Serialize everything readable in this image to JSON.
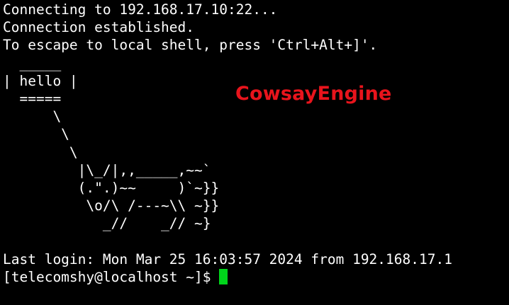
{
  "terminal": {
    "connect_lines": [
      "Connecting to 192.168.17.10:22...",
      "Connection established.",
      "To escape to local shell, press 'Ctrl+Alt+]'."
    ],
    "cowsay_lines": [
      "  _____",
      "| hello |",
      "  =====",
      "      \\",
      "       \\",
      "        \\",
      "         |\\_/|,,_____,~~`",
      "         (.\".)~~     )`~}}",
      "          \\o/\\ /---~\\\\ ~}}",
      "            _//    _// ~}"
    ],
    "last_login": "Last login: Mon Mar 25 16:03:57 2024 from 192.168.17.1",
    "prompt": "[telecomshy@localhost ~]$ "
  },
  "watermark": {
    "text": "CowsayEngine",
    "color": "#e8141c"
  },
  "colors": {
    "background": "#000000",
    "foreground": "#ffffff",
    "cursor": "#00d51b"
  }
}
